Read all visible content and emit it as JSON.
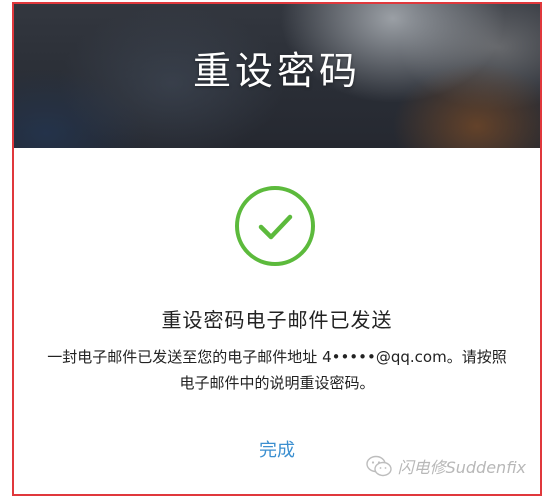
{
  "header": {
    "title": "重设密码"
  },
  "status": {
    "icon": "checkmark-circle-icon",
    "color": "#5cba3c"
  },
  "confirmation": {
    "heading": "重设密码电子邮件已发送",
    "message_prefix": "一封电子邮件已发送至您的电子邮件地址 ",
    "email": "4•••••@qq.com",
    "message_suffix": "。请按照电子邮件中的说明重设密码。"
  },
  "actions": {
    "done_label": "完成",
    "done_color": "#3b8fd0"
  },
  "watermark": {
    "icon": "wechat-icon",
    "text": "闪电修Suddenfix"
  }
}
